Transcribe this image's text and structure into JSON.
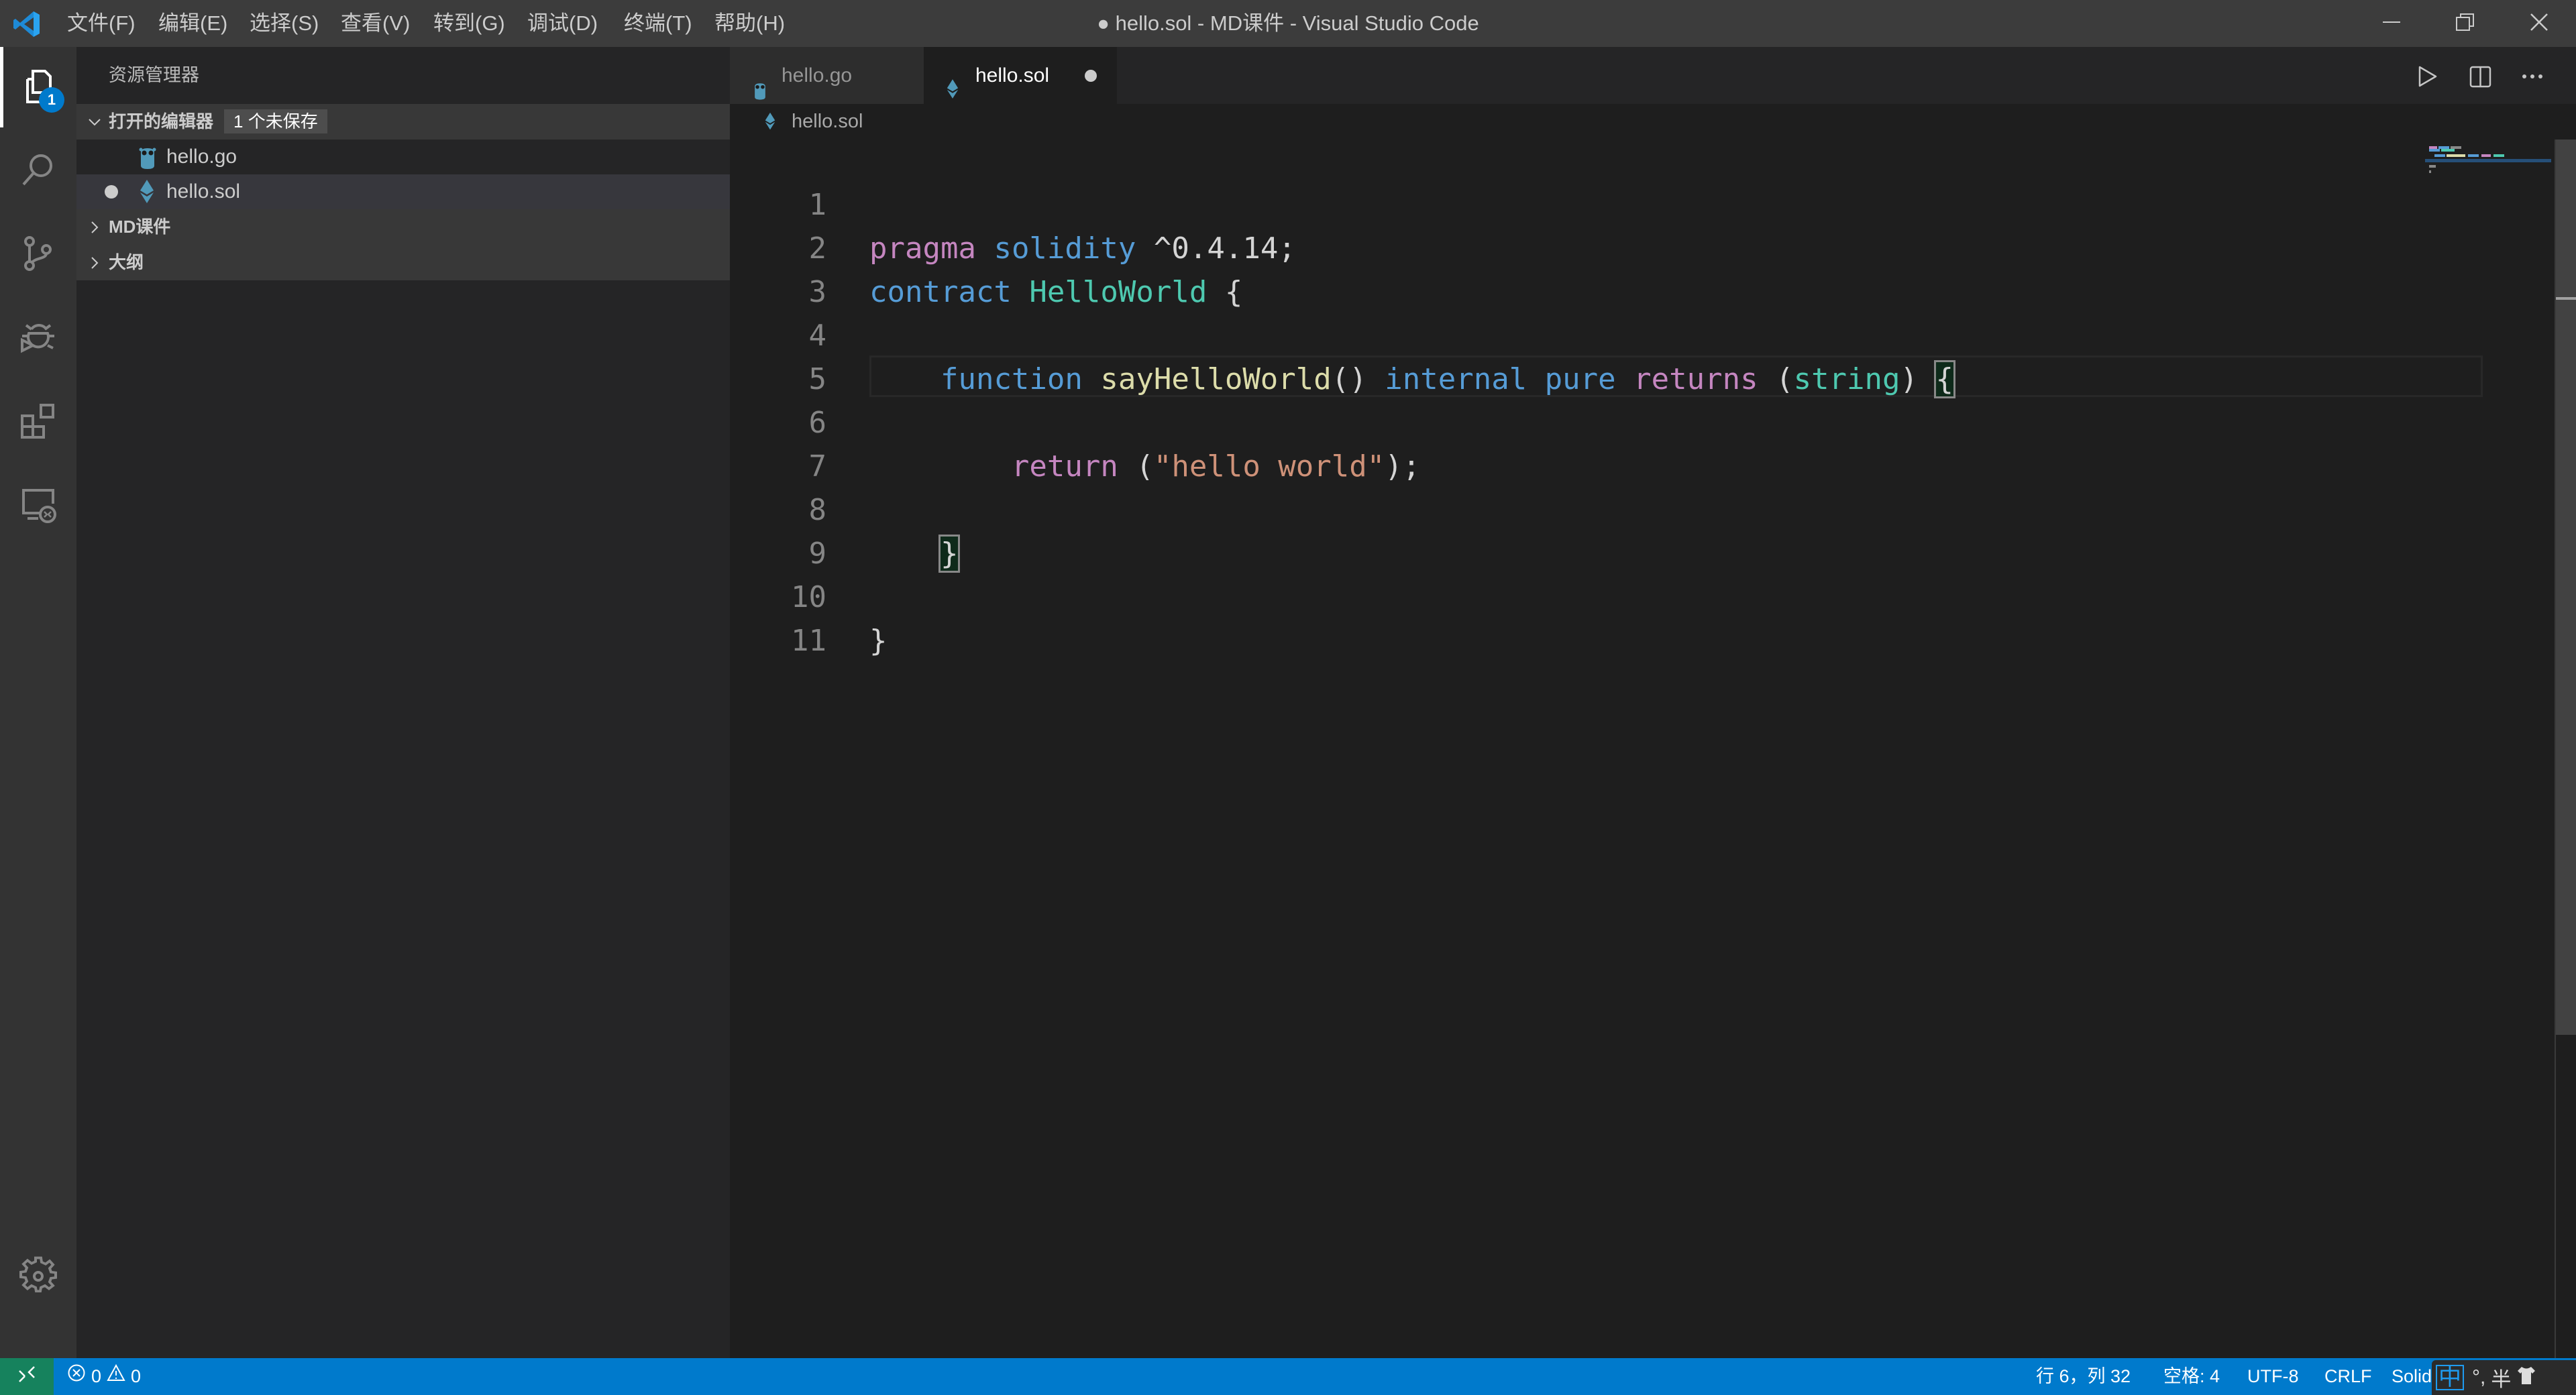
{
  "titlebar": {
    "menus": [
      "文件(F)",
      "编辑(E)",
      "选择(S)",
      "查看(V)",
      "转到(G)",
      "调试(D)",
      "终端(T)",
      "帮助(H)"
    ],
    "window_title": "● hello.sol - MD课件 - Visual Studio Code",
    "icons": [
      "vscode-logo-icon",
      "minimize-icon",
      "restore-icon",
      "close-icon"
    ]
  },
  "activitybar": {
    "items": [
      "explorer-icon",
      "search-icon",
      "source-control-icon",
      "debug-icon",
      "extensions-icon",
      "remote-explorer-icon"
    ],
    "explorer_badge": "1",
    "bottom": "settings-gear-icon"
  },
  "sidebar": {
    "title": "资源管理器",
    "open_editors": {
      "label": "打开的编辑器",
      "badge": "1 个未保存",
      "files": [
        {
          "name": "hello.go",
          "icon": "go-gopher-icon",
          "dirty": false
        },
        {
          "name": "hello.sol",
          "icon": "ethereum-icon",
          "dirty": true
        }
      ]
    },
    "sections": [
      "MD课件",
      "大纲"
    ]
  },
  "tabs": [
    {
      "label": "hello.go",
      "icon": "go-gopher-icon",
      "active": false
    },
    {
      "label": "hello.sol",
      "icon": "ethereum-icon",
      "active": true,
      "dirty": true
    }
  ],
  "editor_actions": [
    "run-icon",
    "split-editor-icon",
    "more-actions-icon"
  ],
  "breadcrumb": {
    "file": "hello.sol"
  },
  "editor": {
    "line_numbers": [
      "1",
      "2",
      "3",
      "4",
      "5",
      "6",
      "7",
      "8",
      "9",
      "10",
      "11"
    ],
    "lines": {
      "l1": {
        "t1": "pragma",
        "t2": "solidity",
        "t3": "^0.4.14;"
      },
      "l2": {
        "t1": "contract",
        "t2": "HelloWorld",
        "t3": "{"
      },
      "l4": {
        "t1": "function",
        "t2": "sayHelloWorld",
        "t3": "()",
        "t4": "internal",
        "t5": "pure",
        "t6": "returns",
        "t7": "(",
        "t8": "string",
        "t9": ")",
        "t10": "{"
      },
      "l6": {
        "t1": "return",
        "t2": "(",
        "t3": "\"hello world\"",
        "t4": ");"
      },
      "l8": {
        "t1": "}"
      },
      "l10": {
        "t1": "}"
      }
    }
  },
  "statusbar": {
    "errors": "0",
    "warnings": "0",
    "cursor_position": "行 6，列 32",
    "indentation": "空格: 4",
    "encoding": "UTF-8",
    "line_ending": "CRLF",
    "language": "Solidity",
    "ime": {
      "mode": "中",
      "punct": "°,",
      "width": "半"
    }
  },
  "colors": {
    "accent": "#007acc",
    "remote": "#16825d",
    "keyword_pink": "#c586c0",
    "keyword_blue": "#569cd6",
    "type_teal": "#4ec9b0",
    "function_yellow": "#dcdcaa",
    "string_orange": "#ce9178"
  }
}
